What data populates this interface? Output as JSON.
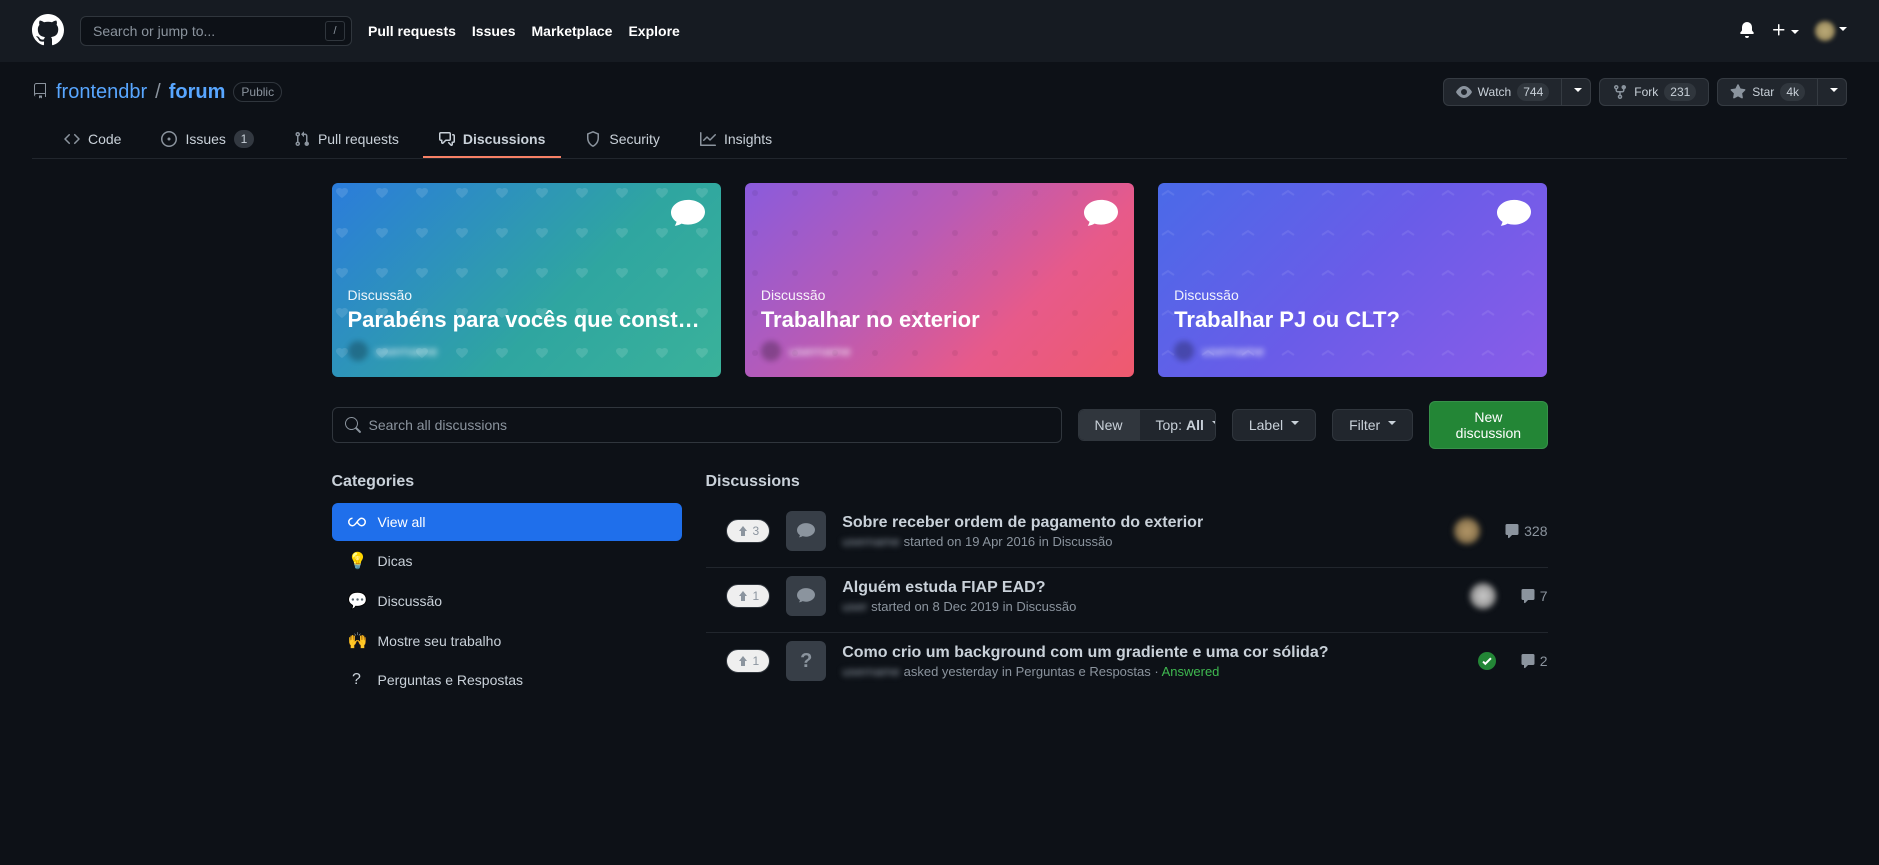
{
  "search": {
    "placeholder": "Search or jump to...",
    "key": "/"
  },
  "topnav": {
    "pulls": "Pull requests",
    "issues": "Issues",
    "marketplace": "Marketplace",
    "explore": "Explore"
  },
  "repo": {
    "owner": "frontendbr",
    "name": "forum",
    "visibility": "Public",
    "watch_label": "Watch",
    "watch_count": "744",
    "fork_label": "Fork",
    "fork_count": "231",
    "star_label": "Star",
    "star_count": "4k"
  },
  "tabs": {
    "code": "Code",
    "issues": "Issues",
    "issues_count": "1",
    "pulls": "Pull requests",
    "discussions": "Discussions",
    "security": "Security",
    "insights": "Insights"
  },
  "spotlights": [
    {
      "category": "Discussão",
      "title": "Parabéns para vocês que constroem …",
      "author": "blurred"
    },
    {
      "category": "Discussão",
      "title": "Trabalhar no exterior",
      "author": "blurred"
    },
    {
      "category": "Discussão",
      "title": "Trabalhar PJ ou CLT?",
      "author": "blurred"
    }
  ],
  "search_disc": {
    "placeholder": "Search all discussions"
  },
  "controls": {
    "new": "New",
    "top_prefix": "Top:",
    "top_value": "All",
    "label": "Label",
    "filter": "Filter",
    "new_discussion": "New discussion"
  },
  "sidebar": {
    "heading": "Categories",
    "items": [
      {
        "emoji": "∞",
        "label": "View all",
        "selected": true,
        "svg": true
      },
      {
        "emoji": "💡",
        "label": "Dicas"
      },
      {
        "emoji": "💬",
        "label": "Discussão"
      },
      {
        "emoji": "🙌",
        "label": "Mostre seu trabalho"
      },
      {
        "emoji": "❔",
        "label": "Perguntas e Respostas"
      }
    ]
  },
  "list": {
    "heading": "Discussions",
    "items": [
      {
        "votes": "3",
        "type": "chat",
        "title": "Sobre receber ordem de pagamento do exterior",
        "user": "user",
        "meta": " started on 19 Apr 2016 in Discussão",
        "comments": "328"
      },
      {
        "votes": "1",
        "type": "chat",
        "title": "Alguém estuda FIAP EAD?",
        "user": "user",
        "meta": " started on 8 Dec 2019 in Discussão",
        "comments": "7"
      },
      {
        "votes": "1",
        "type": "question",
        "title": "Como crio um background com um gradiente e uma cor sólida?",
        "user": "user",
        "meta_prefix": " asked yesterday in Perguntas e Respostas · ",
        "answered": "Answered",
        "comments": "2",
        "answered_flag": true
      }
    ]
  }
}
